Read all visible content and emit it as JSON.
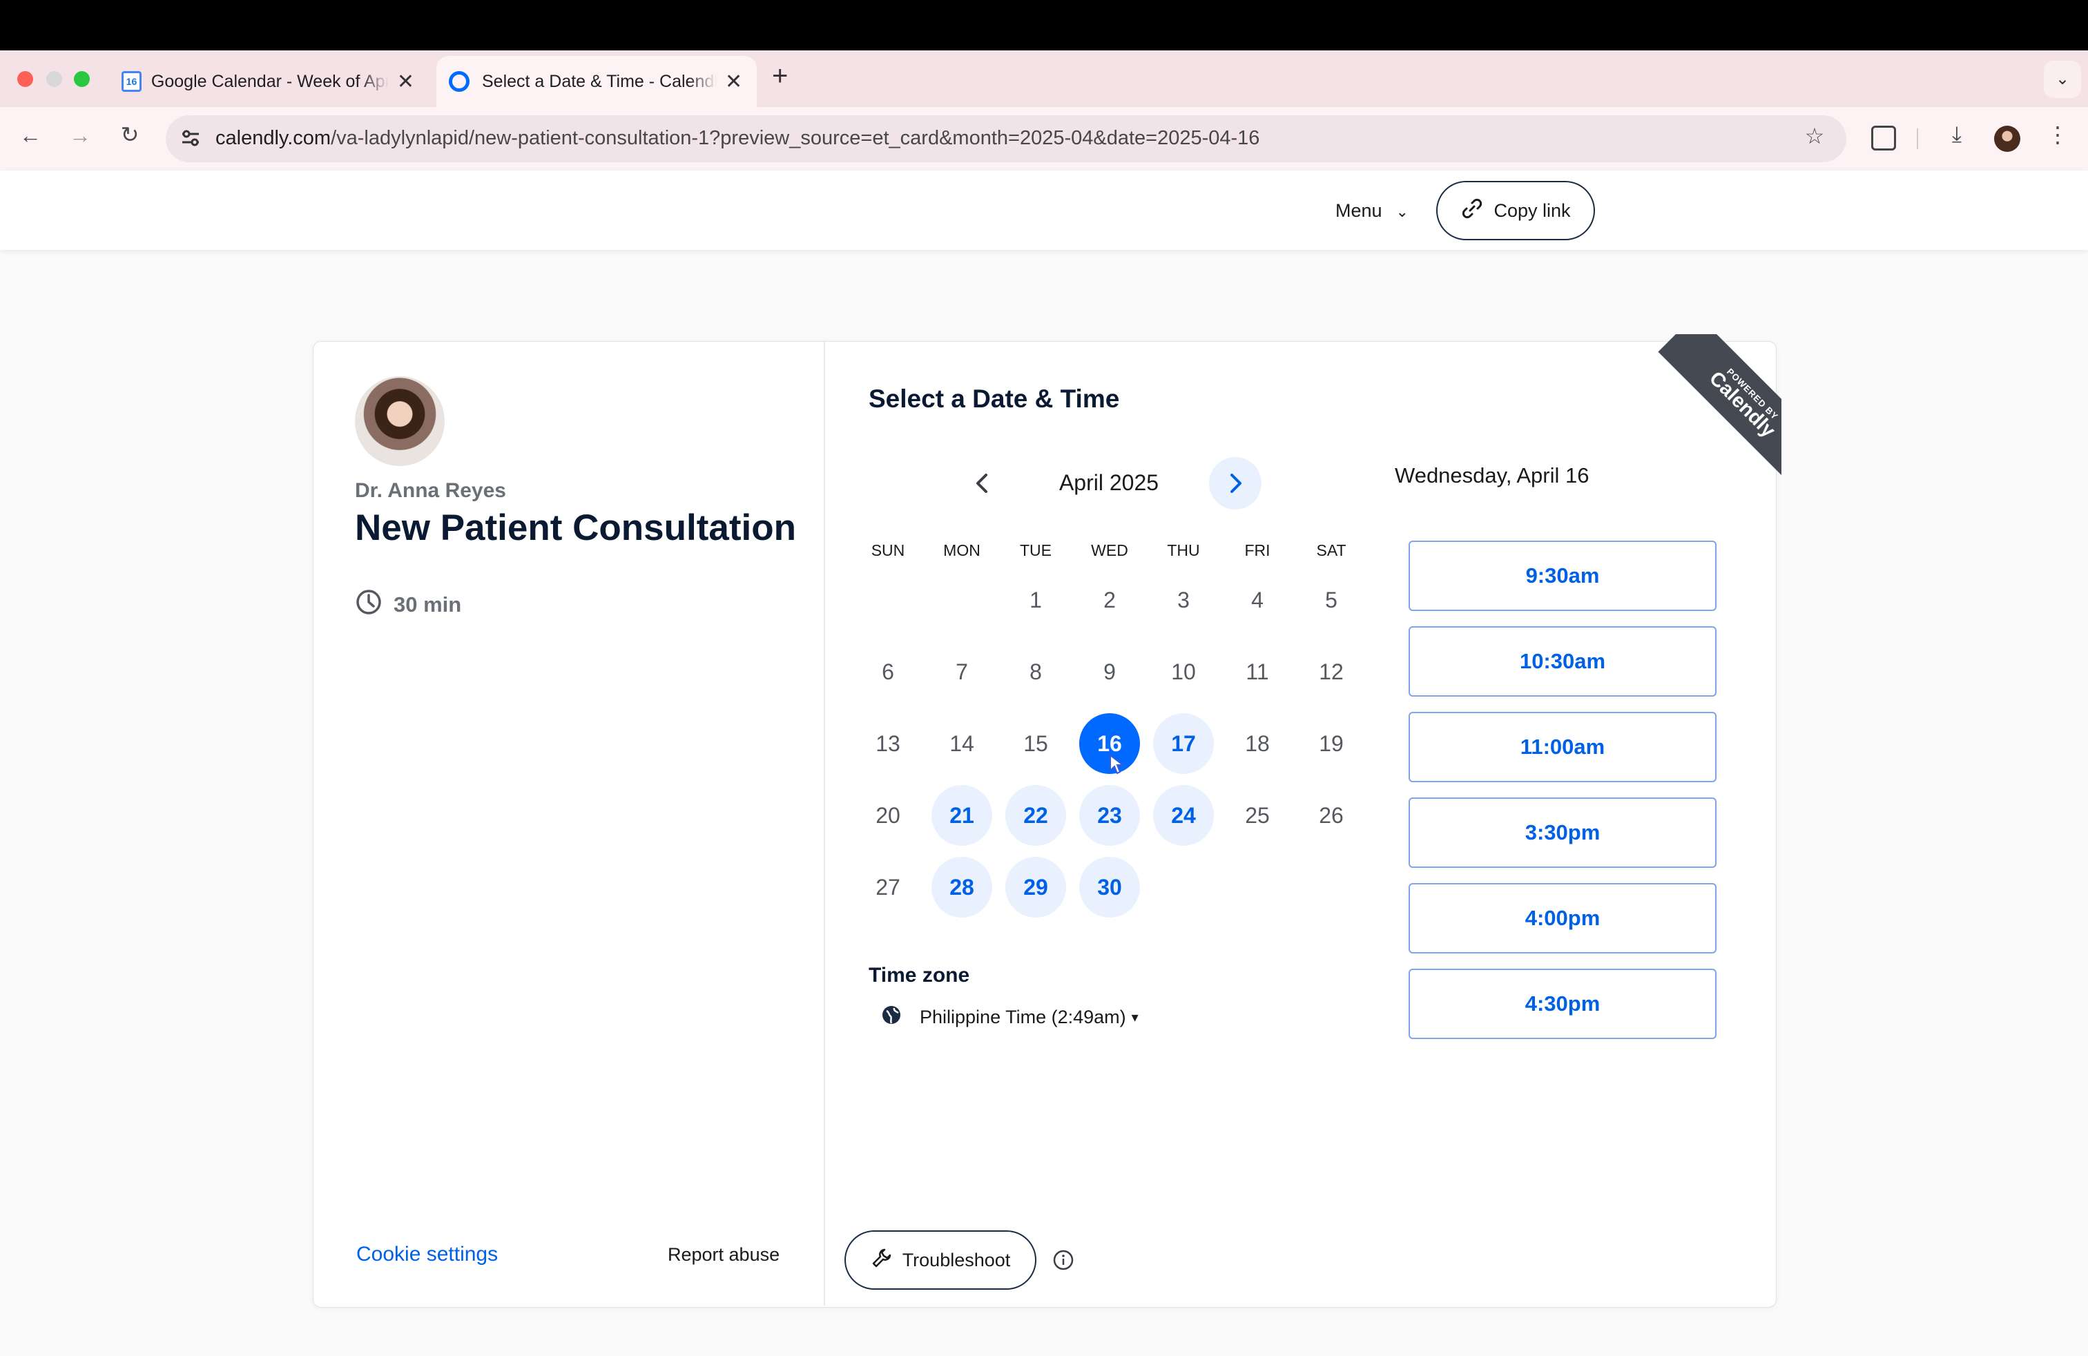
{
  "browser": {
    "tabs": [
      {
        "label": "Google Calendar - Week of April",
        "favicon": "google-calendar-icon"
      },
      {
        "label": "Select a Date & Time - Calendly",
        "favicon": "calendly-icon",
        "active": true
      }
    ],
    "new_tab": "+",
    "favicon_gcal_number": "16",
    "url_host": "calendly.com",
    "url_path": "/va-ladylynlapid/new-patient-consultation-1?preview_source=et_card&month=2025-04&date=2025-04-16"
  },
  "header": {
    "menu_label": "Menu",
    "copy_link_label": "Copy link"
  },
  "event": {
    "host": "Dr. Anna Reyes",
    "title": "New Patient Consultation",
    "duration": "30 min"
  },
  "scheduler": {
    "heading": "Select a Date & Time",
    "month_label": "April 2025",
    "weekdays": [
      "SUN",
      "MON",
      "TUE",
      "WED",
      "THU",
      "FRI",
      "SAT"
    ],
    "days": [
      "1",
      "2",
      "3",
      "4",
      "5",
      "6",
      "7",
      "8",
      "9",
      "10",
      "11",
      "12",
      "13",
      "14",
      "15",
      "16",
      "17",
      "18",
      "19",
      "20",
      "21",
      "22",
      "23",
      "24",
      "25",
      "26",
      "27",
      "28",
      "29",
      "30"
    ],
    "available_days": [
      "16",
      "17",
      "21",
      "22",
      "23",
      "24",
      "28",
      "29",
      "30"
    ],
    "selected_day": "16",
    "timezone_label": "Time zone",
    "timezone_value": "Philippine Time (2:49am)",
    "selected_date_heading": "Wednesday, April 16",
    "time_slots": [
      "9:30am",
      "10:30am",
      "11:00am",
      "3:30pm",
      "4:00pm",
      "4:30pm"
    ]
  },
  "footer": {
    "cookie_settings": "Cookie settings",
    "report_abuse": "Report abuse",
    "troubleshoot": "Troubleshoot"
  },
  "ribbon": {
    "powered_by": "POWERED BY",
    "brand": "Calendly"
  },
  "colors": {
    "accent": "#0069ff",
    "available_bg": "#e9f0fe",
    "dark_text": "#0b1a33",
    "tabstrip": "#f5e2e7"
  }
}
